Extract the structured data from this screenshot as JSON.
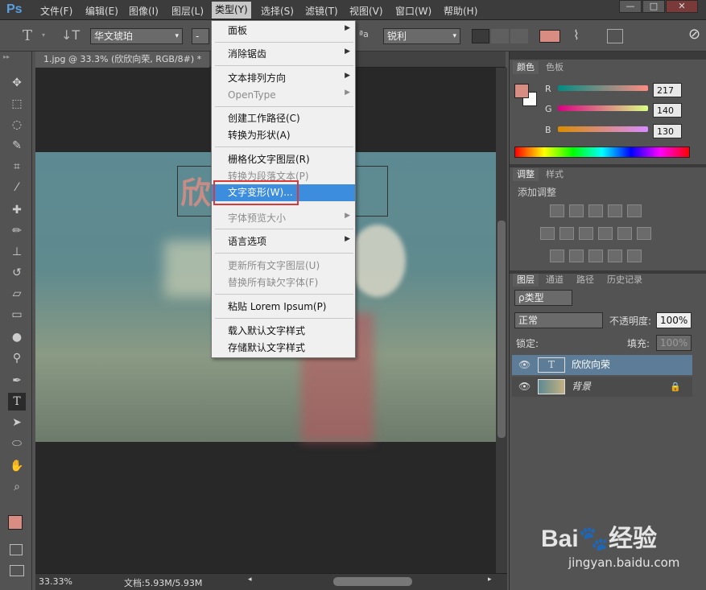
{
  "app": {
    "logo": "Ps"
  },
  "menubar": {
    "items": [
      "文件(F)",
      "编辑(E)",
      "图像(I)",
      "图层(L)",
      "类型(Y)",
      "选择(S)",
      "滤镜(T)",
      "视图(V)",
      "窗口(W)",
      "帮助(H)"
    ],
    "window_buttons": [
      "—",
      "□",
      "✕"
    ]
  },
  "options": {
    "font": "华文琥珀",
    "aa_icon": "ªa",
    "antialias": "锐利",
    "dash": "-"
  },
  "document": {
    "tab": "1.jpg @ 33.3% (欣欣向荣, RGB/8#) *",
    "canvas_text": "欣欣向荣"
  },
  "status": {
    "zoom": "33.33%",
    "docsize": "文档:5.93M/5.93M"
  },
  "type_menu": {
    "items": [
      {
        "label": "面板",
        "disabled": false,
        "submenu": true
      },
      {
        "label": "消除锯齿",
        "disabled": false,
        "submenu": true
      },
      {
        "label": "文本排列方向",
        "disabled": false,
        "submenu": true
      },
      {
        "label": "OpenType",
        "disabled": true,
        "submenu": true
      },
      {
        "label": "创建工作路径(C)",
        "disabled": false,
        "submenu": false
      },
      {
        "label": "转换为形状(A)",
        "disabled": false,
        "submenu": false
      },
      {
        "label": "栅格化文字图层(R)",
        "disabled": false,
        "submenu": false
      },
      {
        "label": "转换为段落文本(P)",
        "disabled": true,
        "submenu": false
      },
      {
        "label": "文字变形(W)...",
        "disabled": false,
        "submenu": false,
        "highlighted": true
      },
      {
        "label": "字体预览大小",
        "disabled": true,
        "submenu": true
      },
      {
        "label": "语言选项",
        "disabled": false,
        "submenu": true
      },
      {
        "label": "更新所有文字图层(U)",
        "disabled": true,
        "submenu": false
      },
      {
        "label": "替换所有缺欠字体(F)",
        "disabled": true,
        "submenu": false
      },
      {
        "label": "粘贴 Lorem Ipsum(P)",
        "disabled": false,
        "submenu": false
      },
      {
        "label": "载入默认文字样式",
        "disabled": false,
        "submenu": false
      },
      {
        "label": "存储默认文字样式",
        "disabled": false,
        "submenu": false
      }
    ]
  },
  "color_panel": {
    "tabs": [
      "颜色",
      "色板"
    ],
    "r_label": "R",
    "g_label": "G",
    "b_label": "B",
    "r": "217",
    "g": "140",
    "b": "130",
    "foreground": "#d98c82"
  },
  "adjust_panel": {
    "tabs": [
      "调整",
      "样式"
    ],
    "title": "添加调整"
  },
  "layers_panel": {
    "tabs": [
      "图层",
      "通道",
      "路径",
      "历史记录"
    ],
    "filter": "ρ类型",
    "blend": "正常",
    "opacity_label": "不透明度:",
    "opacity": "100%",
    "lock_label": "锁定:",
    "fill_label": "填充:",
    "fill": "100%",
    "layers": [
      {
        "name": "欣欣向荣",
        "thumb": "T",
        "selected": true
      },
      {
        "name": "背景",
        "selected": false,
        "locked": true
      }
    ]
  },
  "watermark": {
    "brand": "Bai",
    "brand2": "经验",
    "url": "jingyan.baidu.com"
  }
}
